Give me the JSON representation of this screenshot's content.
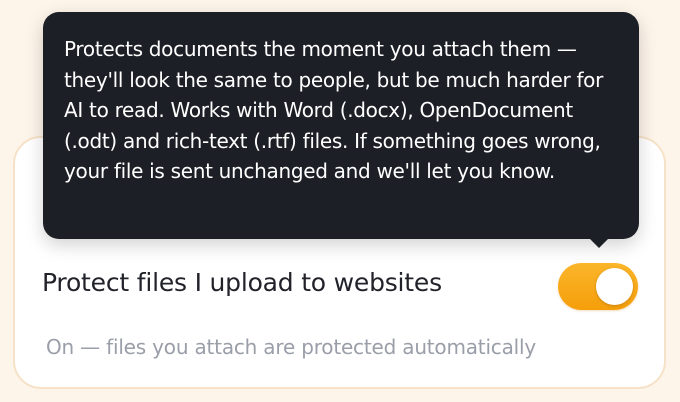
{
  "setting": {
    "label": "Protect files I upload to websites",
    "status": "On — files you attach are protected automatically",
    "enabled": true
  },
  "tooltip": {
    "text": "Protects documents the moment you attach them — they'll look the same to people, but be much harder for AI to read. Works with Word (.docx), OpenDocument (.odt) and rich-text (.rtf) files. If something goes wrong, your file is sent unchanged and we'll let you know."
  },
  "colors": {
    "page_background": "#fdf4ea",
    "card_background": "#ffffff",
    "card_border": "#f6e2c8",
    "toggle_on": "#f59e0b",
    "tooltip_background": "#1d1f26",
    "label_text": "#22232a",
    "status_text": "#9a9ea8"
  }
}
